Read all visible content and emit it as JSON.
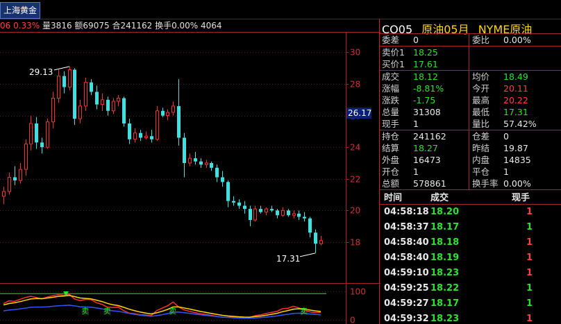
{
  "tab": {
    "label": "上海黄金"
  },
  "infoline": {
    "change": "06 0.33%",
    "volume": "量3816",
    "amount": "额69075",
    "oi": "合241162",
    "turnover": "换手0.00%",
    "extra": "4064"
  },
  "quote": {
    "code": "CO05",
    "name": "原油05月",
    "exchange": "NYME原油",
    "weicha_label": "委差",
    "weicha": "0",
    "weibi_label": "委比",
    "weibi": "0.00%",
    "sell1_label": "卖价1",
    "sell1": "18.25",
    "buy1_label": "买价1",
    "buy1": "17.61",
    "last_label": "成交",
    "last": "18.12",
    "avg_label": "均价",
    "avg": "18.49",
    "chgpct_label": "涨幅",
    "chgpct": "-8.81%",
    "open_label": "今开",
    "open": "20.11",
    "chg_label": "涨跌",
    "chg": "-1.75",
    "high_label": "最高",
    "high": "20.22",
    "vol_label": "总量",
    "vol": "31308",
    "low_label": "最低",
    "low": "17.31",
    "cur_label": "现手",
    "cur": "1",
    "amp_label": "量比",
    "amp": "57.42%",
    "oi_label": "持仓",
    "oi": "241162",
    "oidiff_label": "仓差",
    "oidiff": "0",
    "settle_label": "结算",
    "settle": "18.27",
    "presettle_label": "昨结",
    "presettle": "19.87",
    "outer_label": "外盘",
    "outer": "16473",
    "inner_label": "内盘",
    "inner": "14835",
    "openpos_label": "开仓",
    "openpos": "1",
    "closepos_label": "平仓",
    "closepos": "1",
    "amount_label": "总额",
    "amount": "578861",
    "turn_label": "换手率",
    "turn": "0.00%"
  },
  "ticks": {
    "headers": [
      "时间",
      "成交",
      "现手"
    ],
    "rows": [
      {
        "time": "04:58:18",
        "price": "18.20",
        "qty": "1",
        "dir": "red"
      },
      {
        "time": "04:58:37",
        "price": "18.17",
        "qty": "1",
        "dir": "green"
      },
      {
        "time": "04:58:40",
        "price": "18.18",
        "qty": "1",
        "dir": "red"
      },
      {
        "time": "04:58:40",
        "price": "18.19",
        "qty": "1",
        "dir": "red"
      },
      {
        "time": "04:59:10",
        "price": "18.23",
        "qty": "1",
        "dir": "red"
      },
      {
        "time": "04:59:25",
        "price": "18.22",
        "qty": "1",
        "dir": "green"
      },
      {
        "time": "04:59:27",
        "price": "18.17",
        "qty": "1",
        "dir": "green"
      },
      {
        "time": "04:59:32",
        "price": "18.23",
        "qty": "1",
        "dir": "red"
      }
    ]
  },
  "chart_data": {
    "type": "candlestick",
    "y_ticks": [
      "30",
      "28",
      "26",
      "24",
      "22",
      "20",
      "18"
    ],
    "ylim": [
      16.2,
      30.5
    ],
    "current_price_label": "26.17",
    "high_annotation": "29.13",
    "low_annotation": "17.31",
    "colors": {
      "up": "#ff3030",
      "down": "#40e0e0",
      "ma_yellow": "#ffd700"
    },
    "candles": [
      {
        "o": 20.9,
        "h": 21.5,
        "l": 20.4,
        "c": 21.2
      },
      {
        "o": 21.2,
        "h": 22.4,
        "l": 21.0,
        "c": 22.1
      },
      {
        "o": 22.1,
        "h": 22.8,
        "l": 21.6,
        "c": 21.9
      },
      {
        "o": 21.9,
        "h": 23.0,
        "l": 21.7,
        "c": 22.6
      },
      {
        "o": 22.6,
        "h": 24.5,
        "l": 22.2,
        "c": 24.2
      },
      {
        "o": 24.2,
        "h": 26.0,
        "l": 23.8,
        "c": 25.5
      },
      {
        "o": 25.5,
        "h": 25.9,
        "l": 23.9,
        "c": 24.3
      },
      {
        "o": 24.3,
        "h": 24.6,
        "l": 23.6,
        "c": 24.0
      },
      {
        "o": 24.0,
        "h": 25.8,
        "l": 23.9,
        "c": 25.6
      },
      {
        "o": 25.6,
        "h": 27.5,
        "l": 25.2,
        "c": 27.1
      },
      {
        "o": 27.1,
        "h": 28.9,
        "l": 26.8,
        "c": 28.5
      },
      {
        "o": 28.5,
        "h": 28.8,
        "l": 27.4,
        "c": 27.8
      },
      {
        "o": 27.8,
        "h": 29.1,
        "l": 27.6,
        "c": 28.9
      },
      {
        "o": 28.9,
        "h": 29.0,
        "l": 25.4,
        "c": 25.8
      },
      {
        "o": 25.8,
        "h": 27.0,
        "l": 25.5,
        "c": 26.6
      },
      {
        "o": 26.6,
        "h": 28.4,
        "l": 26.3,
        "c": 28.1
      },
      {
        "o": 28.1,
        "h": 28.3,
        "l": 27.3,
        "c": 27.5
      },
      {
        "o": 27.5,
        "h": 27.9,
        "l": 26.4,
        "c": 26.7
      },
      {
        "o": 26.7,
        "h": 27.4,
        "l": 26.3,
        "c": 27.0
      },
      {
        "o": 27.0,
        "h": 27.2,
        "l": 26.0,
        "c": 26.3
      },
      {
        "o": 26.3,
        "h": 27.1,
        "l": 26.1,
        "c": 26.9
      },
      {
        "o": 26.9,
        "h": 27.3,
        "l": 26.6,
        "c": 27.1
      },
      {
        "o": 27.1,
        "h": 27.2,
        "l": 25.3,
        "c": 25.5
      },
      {
        "o": 25.5,
        "h": 25.8,
        "l": 24.2,
        "c": 24.5
      },
      {
        "o": 24.5,
        "h": 25.2,
        "l": 24.3,
        "c": 24.9
      },
      {
        "o": 24.9,
        "h": 25.1,
        "l": 24.4,
        "c": 24.6
      },
      {
        "o": 24.6,
        "h": 25.0,
        "l": 24.5,
        "c": 24.7
      },
      {
        "o": 24.7,
        "h": 25.1,
        "l": 24.3,
        "c": 24.5
      },
      {
        "o": 24.5,
        "h": 26.6,
        "l": 24.4,
        "c": 26.3
      },
      {
        "o": 26.3,
        "h": 26.5,
        "l": 25.9,
        "c": 26.0
      },
      {
        "o": 26.0,
        "h": 26.4,
        "l": 25.7,
        "c": 26.2
      },
      {
        "o": 26.2,
        "h": 26.9,
        "l": 26.0,
        "c": 26.6
      },
      {
        "o": 26.6,
        "h": 28.3,
        "l": 24.1,
        "c": 24.6
      },
      {
        "o": 24.6,
        "h": 24.9,
        "l": 22.1,
        "c": 23.0
      },
      {
        "o": 23.0,
        "h": 23.6,
        "l": 22.8,
        "c": 23.3
      },
      {
        "o": 23.3,
        "h": 23.7,
        "l": 22.9,
        "c": 23.1
      },
      {
        "o": 23.1,
        "h": 23.3,
        "l": 22.7,
        "c": 22.9
      },
      {
        "o": 22.9,
        "h": 23.2,
        "l": 22.7,
        "c": 23.0
      },
      {
        "o": 23.0,
        "h": 23.1,
        "l": 22.5,
        "c": 22.7
      },
      {
        "o": 22.7,
        "h": 22.9,
        "l": 21.8,
        "c": 22.1
      },
      {
        "o": 22.1,
        "h": 22.5,
        "l": 21.5,
        "c": 21.8
      },
      {
        "o": 21.8,
        "h": 21.9,
        "l": 20.2,
        "c": 20.6
      },
      {
        "o": 20.6,
        "h": 20.9,
        "l": 20.3,
        "c": 20.5
      },
      {
        "o": 20.5,
        "h": 20.7,
        "l": 20.1,
        "c": 20.3
      },
      {
        "o": 20.3,
        "h": 20.6,
        "l": 19.8,
        "c": 20.1
      },
      {
        "o": 20.1,
        "h": 20.3,
        "l": 19.0,
        "c": 19.4
      },
      {
        "o": 19.4,
        "h": 20.3,
        "l": 19.3,
        "c": 20.1
      },
      {
        "o": 20.1,
        "h": 20.3,
        "l": 19.8,
        "c": 19.9
      },
      {
        "o": 19.9,
        "h": 20.2,
        "l": 19.7,
        "c": 20.1
      },
      {
        "o": 20.1,
        "h": 20.3,
        "l": 19.9,
        "c": 20.0
      },
      {
        "o": 20.0,
        "h": 20.1,
        "l": 19.5,
        "c": 19.7
      },
      {
        "o": 19.7,
        "h": 20.2,
        "l": 19.6,
        "c": 20.0
      },
      {
        "o": 20.0,
        "h": 20.1,
        "l": 19.6,
        "c": 19.7
      },
      {
        "o": 19.7,
        "h": 20.0,
        "l": 19.5,
        "c": 19.8
      },
      {
        "o": 19.8,
        "h": 20.0,
        "l": 19.4,
        "c": 19.6
      },
      {
        "o": 19.6,
        "h": 19.9,
        "l": 19.3,
        "c": 19.5
      },
      {
        "o": 19.5,
        "h": 19.6,
        "l": 18.3,
        "c": 18.6
      },
      {
        "o": 18.6,
        "h": 18.8,
        "l": 17.3,
        "c": 17.9
      },
      {
        "o": 17.9,
        "h": 18.4,
        "l": 17.8,
        "c": 18.1
      }
    ],
    "indicator": {
      "y_ticks": [
        "100",
        "0"
      ],
      "ylim": [
        0,
        100
      ],
      "marker_text": "卖"
    }
  }
}
